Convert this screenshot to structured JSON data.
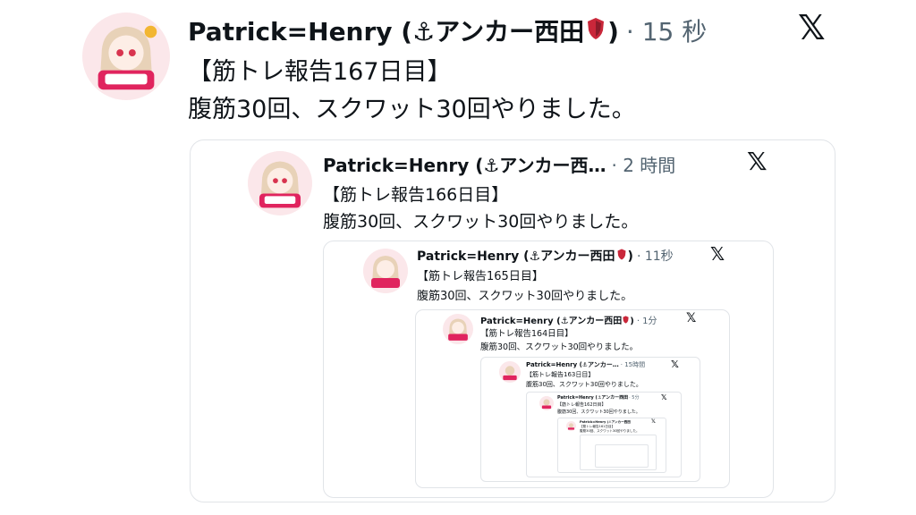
{
  "tweets": [
    {
      "name": "Patrick=Henry (⚓アンカー西田",
      "close": ")",
      "time": "· 15 秒",
      "line1": "【筋トレ報告167日目】",
      "line2": "腹筋30回、スクワット30回やりました。",
      "x": "𝕏"
    },
    {
      "name": "Patrick=Henry (⚓アンカー西…",
      "close": "",
      "time": "· 2 時間",
      "line1": "【筋トレ報告166日目】",
      "line2": "腹筋30回、スクワット30回やりました。",
      "x": "𝕏"
    },
    {
      "name": "Patrick=Henry (⚓アンカー西田",
      "close": ")",
      "time": "· 11秒",
      "line1": "【筋トレ報告165日目】",
      "line2": "腹筋30回、スクワット30回やりました。",
      "x": "𝕏"
    },
    {
      "name": "Patrick=Henry (⚓アンカー西田",
      "close": ")",
      "time": "· 1分",
      "line1": "【筋トレ報告164日目】",
      "line2": "腹筋30回、スクワット30回やりました。",
      "x": "𝕏"
    },
    {
      "name": "Patrick=Henry (⚓アンカー…",
      "close": "",
      "time": "· 15時間",
      "line1": "【筋トレ報告163日目】",
      "line2": "腹筋30回、スクワット30回やりました。",
      "x": "𝕏"
    },
    {
      "name": "Patrick=Henry (⚓アンカー西田",
      "close": ")",
      "time": "· 5分",
      "line1": "【筋トレ報告162日目】",
      "line2": "腹筋30回、スクワット30回やりました。",
      "x": "𝕏"
    },
    {
      "name": "Patrick=Henry (⚓アンカー西田",
      "close": ")",
      "time": "",
      "line1": "【筋トレ報告161日目】",
      "line2": "腹筋30回、スクワット30回やりました。",
      "x": "𝕏"
    }
  ],
  "colors": {
    "text": "#0f1419",
    "muted": "#536471",
    "border": "#e1e4e8",
    "avatar_bg": "#fbeef0",
    "accent_red": "#e0245e"
  },
  "icons": {
    "avatar": "anime-girl-avatar",
    "anchor": "anchor-icon",
    "shield": "shield-icon",
    "x": "x-logo-icon"
  }
}
